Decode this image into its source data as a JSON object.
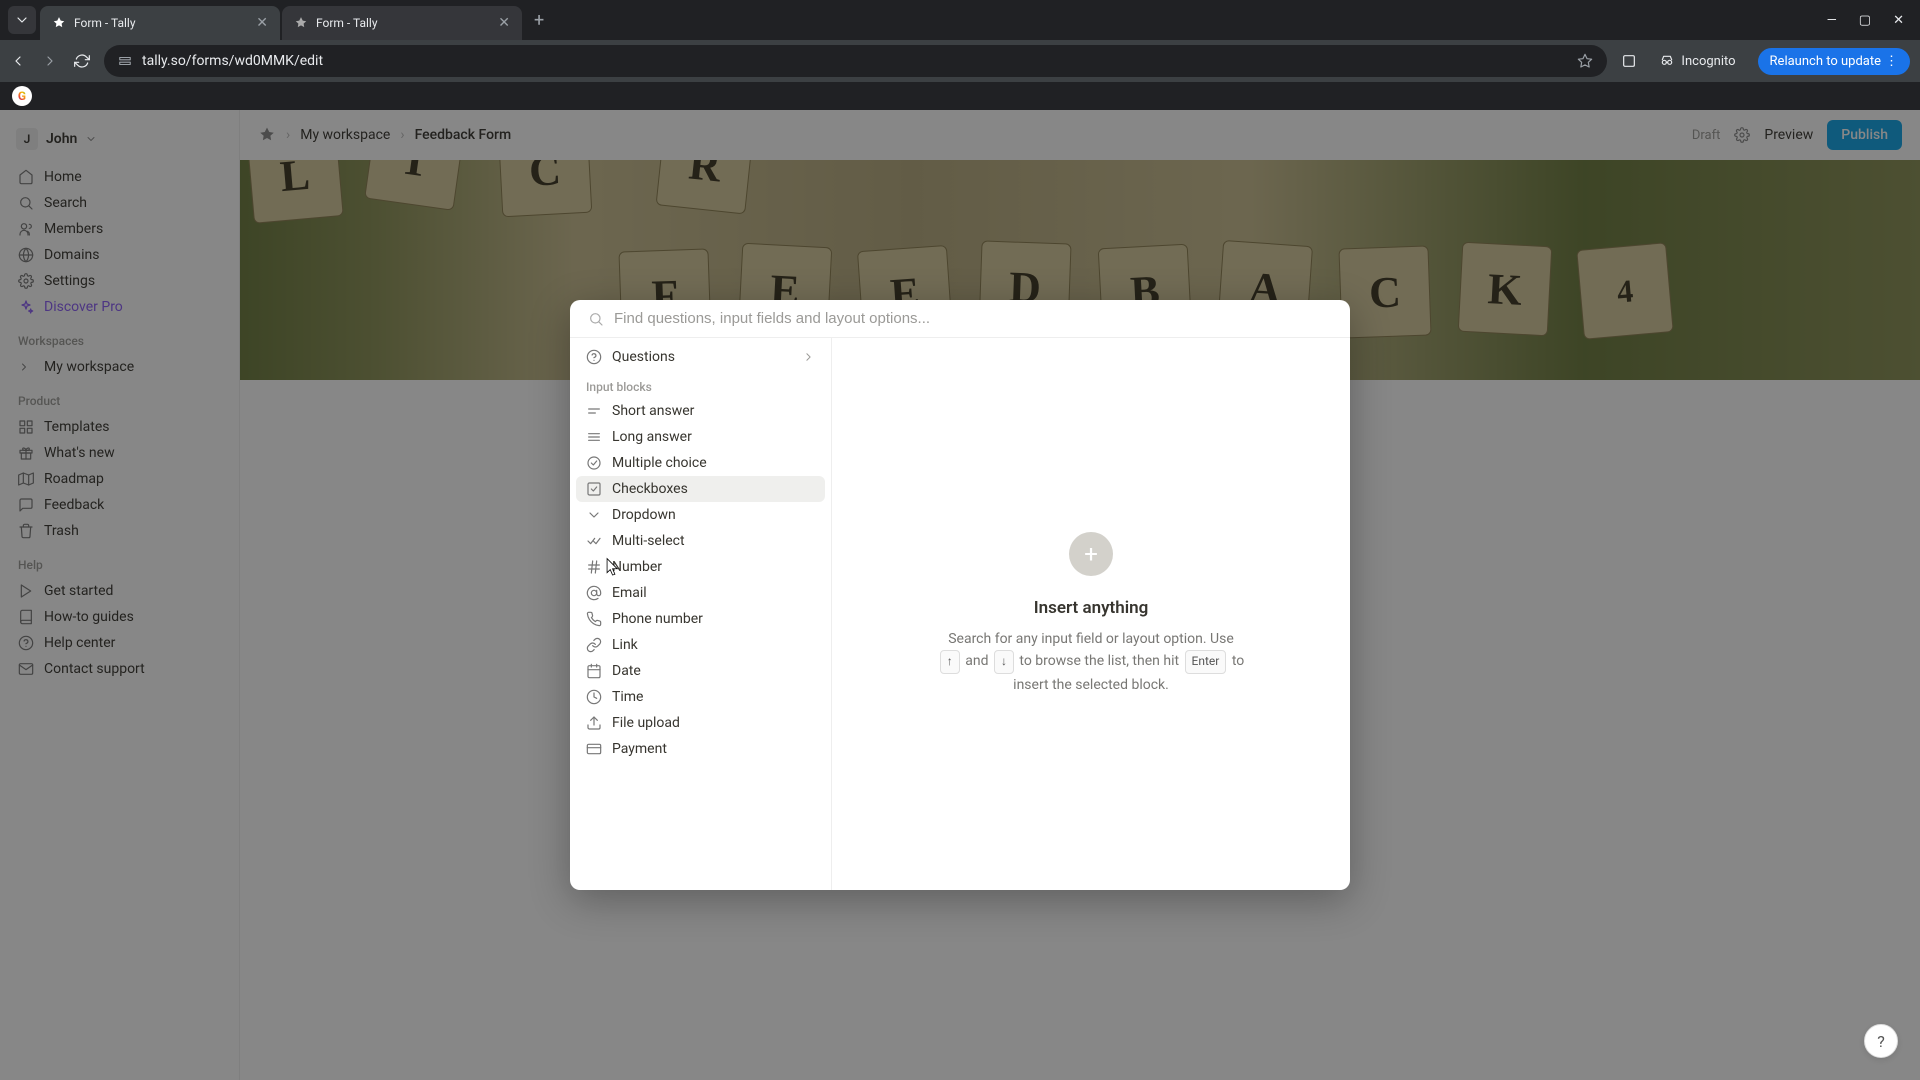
{
  "browser": {
    "tabs": [
      {
        "title": "Form - Tally",
        "active": true
      },
      {
        "title": "Form - Tally",
        "active": false
      }
    ],
    "url_display": "tally.so/forms/wd0MMK/edit",
    "incognito_label": "Incognito",
    "relaunch_label": "Relaunch to update"
  },
  "sidebar": {
    "user_initial": "J",
    "user_name": "John",
    "nav": [
      {
        "label": "Home"
      },
      {
        "label": "Search"
      },
      {
        "label": "Members"
      },
      {
        "label": "Domains"
      },
      {
        "label": "Settings"
      },
      {
        "label": "Discover Pro",
        "accent": true
      }
    ],
    "workspaces_header": "Workspaces",
    "workspaces": [
      {
        "label": "My workspace"
      }
    ],
    "product_header": "Product",
    "product": [
      {
        "label": "Templates"
      },
      {
        "label": "What's new"
      },
      {
        "label": "Roadmap"
      },
      {
        "label": "Feedback"
      },
      {
        "label": "Trash"
      }
    ],
    "help_header": "Help",
    "help": [
      {
        "label": "Get started"
      },
      {
        "label": "How-to guides"
      },
      {
        "label": "Help center"
      },
      {
        "label": "Contact support"
      }
    ]
  },
  "topbar": {
    "breadcrumb_workspace": "My workspace",
    "breadcrumb_form": "Feedback Form",
    "draft_label": "Draft",
    "preview_label": "Preview",
    "publish_label": "Publish"
  },
  "cover": {
    "tiles": [
      "L",
      "T",
      "C",
      "R",
      "F",
      "E",
      "E",
      "D",
      "B",
      "A",
      "C",
      "K",
      "4"
    ]
  },
  "modal": {
    "search_placeholder": "Find questions, input fields and layout options...",
    "questions_label": "Questions",
    "input_blocks_header": "Input blocks",
    "items": [
      {
        "label": "Short answer"
      },
      {
        "label": "Long answer"
      },
      {
        "label": "Multiple choice"
      },
      {
        "label": "Checkboxes",
        "highlighted": true
      },
      {
        "label": "Dropdown"
      },
      {
        "label": "Multi-select"
      },
      {
        "label": "Number"
      },
      {
        "label": "Email"
      },
      {
        "label": "Phone number"
      },
      {
        "label": "Link"
      },
      {
        "label": "Date"
      },
      {
        "label": "Time"
      },
      {
        "label": "File upload"
      },
      {
        "label": "Payment"
      }
    ],
    "preview": {
      "title": "Insert anything",
      "desc_1": "Search for any input field or layout option. Use ",
      "kbd_up": "↑",
      "desc_2": " and ",
      "kbd_down": "↓",
      "desc_3": " to browse the list, then hit ",
      "kbd_enter": "Enter",
      "desc_4": " to insert the selected block."
    }
  }
}
